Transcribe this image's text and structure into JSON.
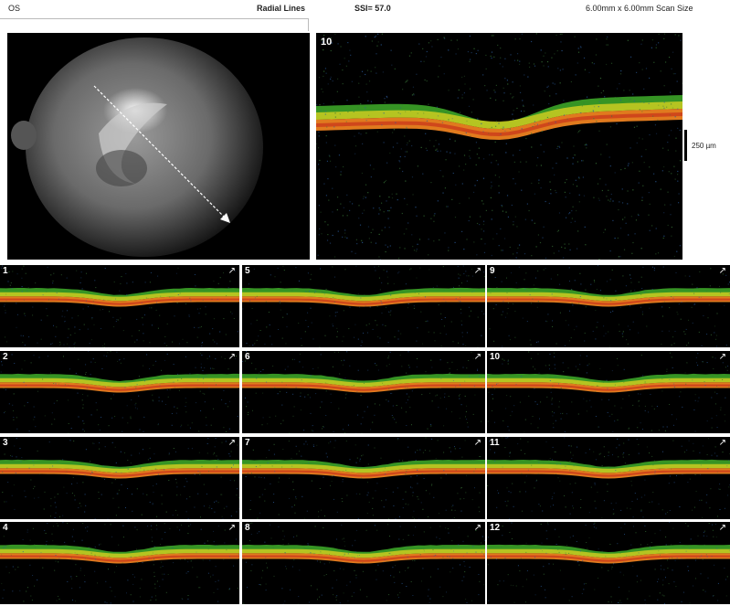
{
  "header": {
    "eye": "OS",
    "scan_pattern": "Radial Lines",
    "ssi": "SSI= 57.0",
    "scan_size": "6.00mm x 6.00mm Scan Size"
  },
  "scale_bar": {
    "label": "250 µm"
  },
  "main_scan": {
    "label": "10"
  },
  "thumbnails": [
    {
      "label": "1"
    },
    {
      "label": "5"
    },
    {
      "label": "9"
    },
    {
      "label": "2"
    },
    {
      "label": "6"
    },
    {
      "label": "10"
    },
    {
      "label": "3"
    },
    {
      "label": "7"
    },
    {
      "label": "11"
    },
    {
      "label": "4"
    },
    {
      "label": "8"
    },
    {
      "label": "12"
    }
  ],
  "colors": {
    "retina_green": "#3fae2a",
    "rpe_orange": "#e07a1e",
    "rpe_red": "#c8321a",
    "noise_blue": "#2a5a9a"
  },
  "icons": {
    "scan_direction": "arrow-icon",
    "fundus_scan_line": "scan-line-arrow-icon"
  }
}
